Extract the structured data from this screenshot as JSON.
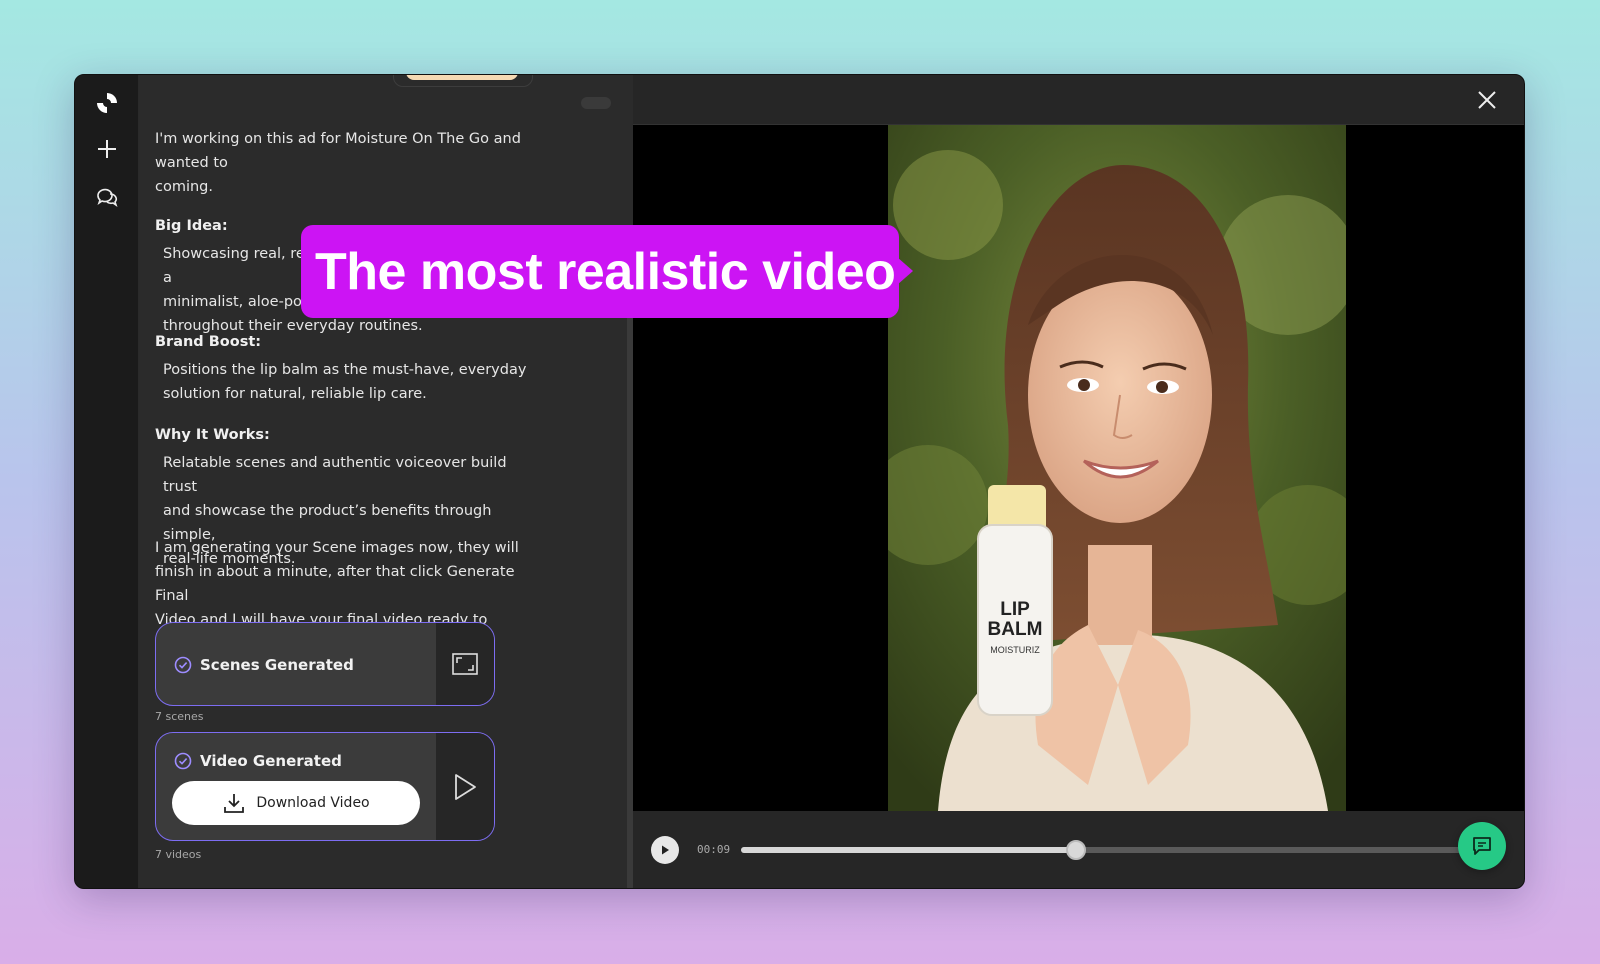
{
  "callout": {
    "text": "The most realistic video"
  },
  "rail": {
    "icons": [
      "logo-icon",
      "plus-icon",
      "chats-icon"
    ]
  },
  "chat": {
    "intro": "I'm working on this ad for Moisture On The Go and wanted to share what's coming.",
    "intro_line1": "I'm working on this ad for Moisture On The Go and",
    "intro_line2": "wanted to",
    "intro_line3": "coming.",
    "sections": [
      {
        "heading": "Big Idea:",
        "lines": [
          "Showcasing real, relatable comfort as people use a",
          "minimalist, aloe-powered lip balm for instant relief",
          "throughout their everyday routines."
        ]
      },
      {
        "heading": "Brand Boost:",
        "lines": [
          "Positions the lip balm as the must-have, everyday",
          "solution for natural, reliable lip care."
        ]
      },
      {
        "heading": "Why It Works:",
        "lines": [
          "Relatable scenes and authentic voiceover build trust",
          "and showcase the product’s benefits through simple,",
          "real-life moments."
        ]
      }
    ],
    "status_lines": [
      "I am generating your Scene images now, they will",
      "finish in about a minute, after that click Generate Final",
      "Video and I will have your final video ready to watch."
    ],
    "scenes_card": {
      "title": "Scenes Generated",
      "caption": "7 scenes"
    },
    "video_card": {
      "title": "Video Generated",
      "download_label": "Download Video",
      "caption": "7 videos"
    }
  },
  "player": {
    "current_time": "00:09",
    "progress": 0.44,
    "product_text_line1": "LIP",
    "product_text_line2": "BALM",
    "product_text_line3": "MOISTURIZ"
  },
  "colors": {
    "accent": "#cc14f4",
    "card_border": "#7d6df2",
    "fab": "#26c986"
  }
}
